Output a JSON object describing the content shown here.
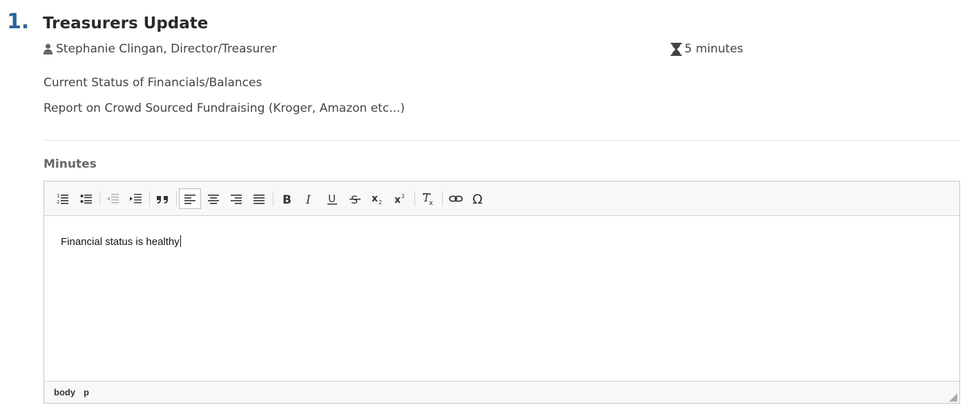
{
  "item": {
    "number": "1.",
    "title": "Treasurers Update",
    "presenter": "Stephanie Clingan, Director/Treasurer",
    "duration": "5 minutes",
    "description": [
      "Current Status of Financials/Balances",
      "Report on Crowd Sourced Fundraising (Kroger, Amazon etc...)"
    ]
  },
  "minutes": {
    "label": "Minutes",
    "content": "Financial status is healthy",
    "elementpath": [
      "body",
      "p"
    ]
  },
  "toolbar": [
    {
      "name": "numbered-list-icon"
    },
    {
      "name": "bulleted-list-icon"
    },
    {
      "name": "decrease-indent-icon"
    },
    {
      "name": "increase-indent-icon"
    },
    {
      "name": "blockquote-icon"
    },
    {
      "name": "align-left-icon",
      "active": true
    },
    {
      "name": "align-center-icon"
    },
    {
      "name": "align-right-icon"
    },
    {
      "name": "justify-icon"
    },
    {
      "name": "bold-icon"
    },
    {
      "name": "italic-icon"
    },
    {
      "name": "underline-icon"
    },
    {
      "name": "strikethrough-icon"
    },
    {
      "name": "subscript-icon"
    },
    {
      "name": "superscript-icon"
    },
    {
      "name": "remove-format-icon"
    },
    {
      "name": "link-icon"
    },
    {
      "name": "special-character-icon"
    }
  ],
  "colors": {
    "number": "#2f6496",
    "text": "#444444",
    "toolbar_bg": "#f8f8f8"
  }
}
